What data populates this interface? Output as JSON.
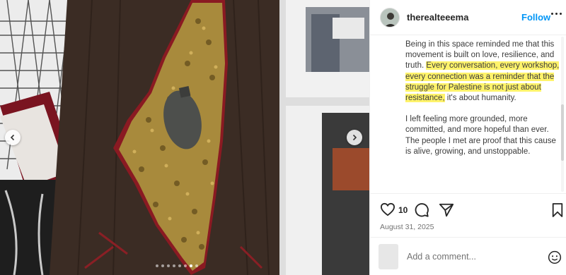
{
  "post": {
    "username": "therealteeema",
    "follow_label": "Follow",
    "caption_p1_plain": "Being in this space reminded me that this movement is built on love, resilience, and truth. ",
    "caption_p1_highlight": "Every conversation, every workshop, every connection was a reminder that the struggle for Palestine is not just about resistance,",
    "caption_p1_tail": " it's about humanity.",
    "caption_p2": "I left feeling more grounded, more committed, and more hopeful than ever. The people I met are proof that this cause is alive, growing, and unstoppable.",
    "likes": "10",
    "date": "August 31, 2025",
    "comment_placeholder": "Add a comment..."
  },
  "media": {
    "slide_count": 8,
    "active_slide": 6
  },
  "icons": {
    "like": "heart-icon",
    "comment": "comment-icon",
    "share": "send-icon",
    "save": "bookmark-icon",
    "emoji": "smiley-icon",
    "prev": "chevron-left-icon",
    "next": "chevron-right-icon",
    "more": "more-options-icon"
  },
  "colors": {
    "accent": "#0095f6",
    "highlight": "#fff36b"
  }
}
